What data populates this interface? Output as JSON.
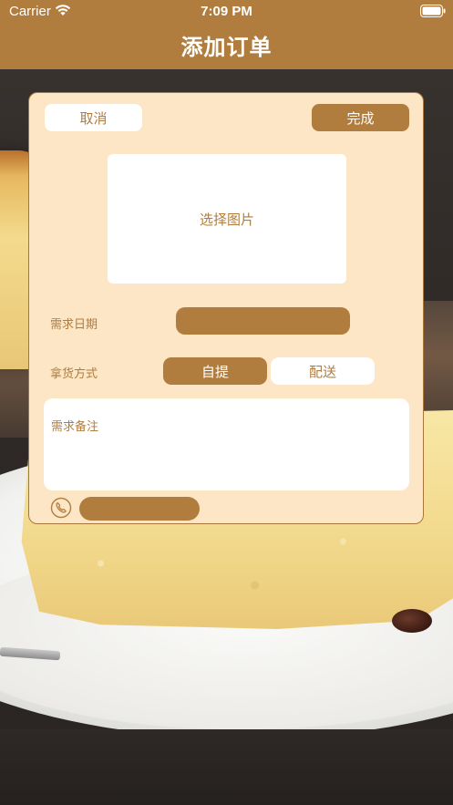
{
  "status_bar": {
    "carrier": "Carrier",
    "time": "7:09 PM"
  },
  "nav": {
    "title": "添加订单"
  },
  "form": {
    "cancel_label": "取消",
    "done_label": "完成",
    "image_picker_label": "选择图片",
    "date_label": "需求日期",
    "delivery_method_label": "拿货方式",
    "delivery_options": [
      "自提",
      "配送"
    ],
    "selected_delivery_option": "自提",
    "notes_placeholder": "需求备注"
  },
  "colors": {
    "accent": "#b07d3e",
    "card_background": "#fde6c5",
    "surface": "#ffffff"
  },
  "icons": {
    "wifi": "wifi-icon",
    "battery": "battery-icon",
    "phone": "phone-icon"
  }
}
